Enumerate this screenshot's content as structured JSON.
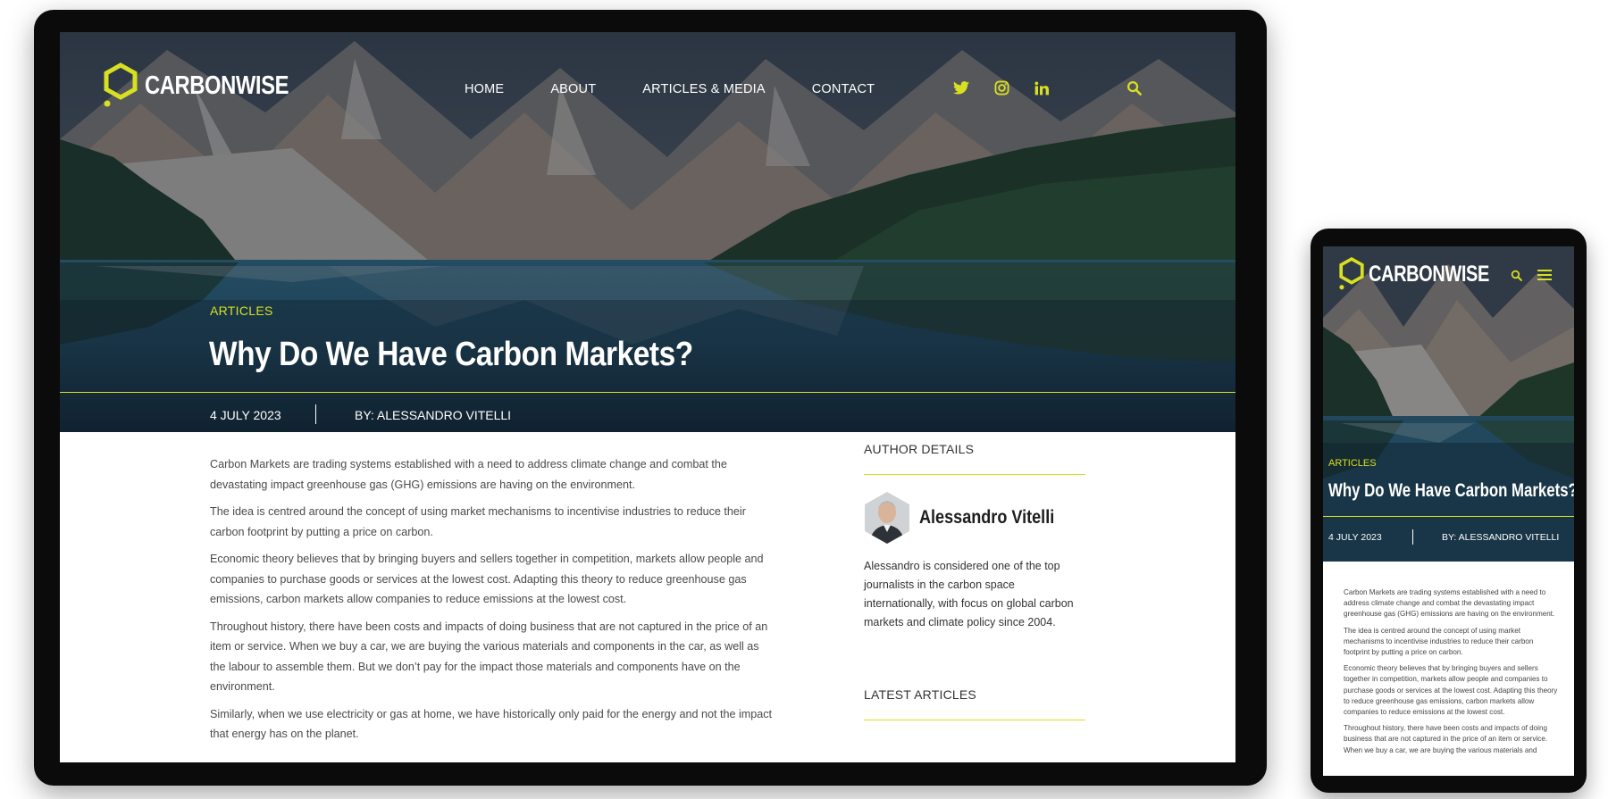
{
  "brand": {
    "name": "CARBONWISE",
    "accent_color": "#d7e021",
    "logo_icon": "hexagon-icon"
  },
  "nav": {
    "items": [
      "HOME",
      "ABOUT",
      "ARTICLES & MEDIA",
      "CONTACT"
    ]
  },
  "social": {
    "icons": [
      "twitter-icon",
      "instagram-icon",
      "linkedin-icon"
    ],
    "search_icon": "search-icon"
  },
  "hero": {
    "category": "ARTICLES",
    "title": "Why Do We Have Carbon Markets?",
    "date": "4 JULY 2023",
    "author": "BY: ALESSANDRO VITELLI"
  },
  "article": {
    "paragraphs": [
      "Carbon Markets are trading systems established with a need to address climate change and combat the devastating impact greenhouse gas (GHG) emissions are having on the environment.",
      "The idea is centred around the concept of using market mechanisms to incentivise industries to reduce their carbon footprint by putting a price on carbon.",
      "Economic theory believes that by bringing buyers and sellers together in competition, markets allow people and companies to purchase goods or services at the lowest cost. Adapting this theory to reduce greenhouse gas emissions, carbon markets allow companies to reduce emissions at the lowest cost.",
      "Throughout history, there have been costs and impacts of doing business that are not captured in the price of an item or service. When we buy a car, we are buying the various materials and components in the car, as well as the labour to assemble them. But we don’t pay for the impact those materials and components have on the environment.",
      "Similarly, when we use electricity or gas at home, we have historically only paid for the energy and not the impact that energy has on the planet."
    ],
    "mobile_paragraphs": [
      "Carbon Markets are trading systems established with a need to address climate change and combat the devastating impact greenhouse gas (GHG) emissions are having on the environment.",
      "The idea is centred around the concept of using market mechanisms to incentivise industries to reduce their carbon footprint by putting a price on carbon.",
      "Economic theory believes that by bringing buyers and sellers together in competition, markets allow people and companies to purchase goods or services at the lowest cost. Adapting this theory to reduce greenhouse gas emissions, carbon markets allow companies to reduce emissions at the lowest cost.",
      "Throughout history, there have been costs and impacts of doing business that are not captured in the price of an item or service. When we buy a car, we are buying the various materials and"
    ]
  },
  "sidebar": {
    "author_heading": "AUTHOR DETAILS",
    "author_name": "Alessandro Vitelli",
    "author_bio": "Alessandro is considered one of the top journalists in the carbon space internationally, with focus on global carbon markets and climate policy since 2004.",
    "latest_heading": "LATEST ARTICLES"
  },
  "mobile": {
    "menu_icon": "hamburger-menu-icon"
  }
}
